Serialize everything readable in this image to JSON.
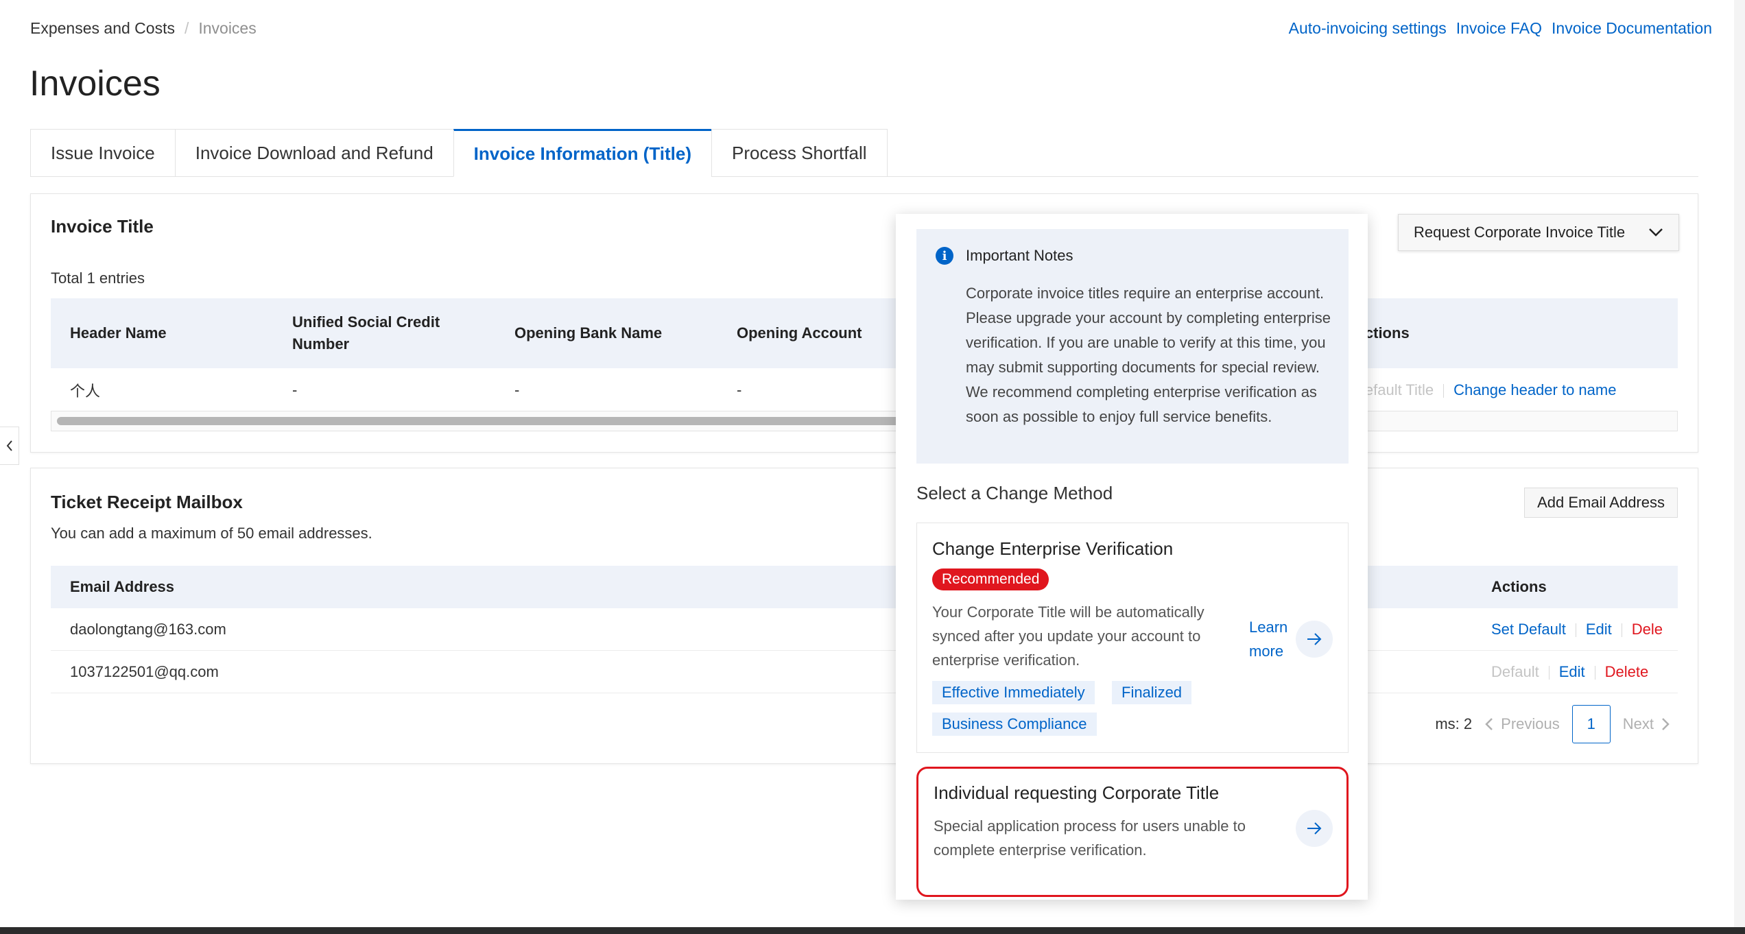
{
  "breadcrumb": {
    "parent": "Expenses and Costs",
    "separator": "/",
    "current": "Invoices"
  },
  "top_links": {
    "auto_invoicing": "Auto-invoicing settings",
    "faq": "Invoice FAQ",
    "docs": "Invoice Documentation"
  },
  "page": {
    "title": "Invoices"
  },
  "tabs": [
    {
      "label": "Issue Invoice"
    },
    {
      "label": "Invoice Download and Refund"
    },
    {
      "label": "Invoice Information (Title)"
    },
    {
      "label": "Process Shortfall"
    }
  ],
  "invoice_title_card": {
    "title": "Invoice Title",
    "total": "Total 1 entries",
    "request_button": "Request Corporate Invoice Title",
    "columns": [
      "Header Name",
      "Unified Social Credit Number",
      "Opening Bank Name",
      "Opening Account",
      "Actions"
    ],
    "row": {
      "header_name": "个人",
      "credit_number": "-",
      "bank_name": "-",
      "account": "-"
    },
    "actions": {
      "default_title": "Default Title",
      "change_header": "Change header to name"
    }
  },
  "mailbox_card": {
    "title": "Ticket Receipt Mailbox",
    "subtitle": "You can add a maximum of 50 email addresses.",
    "add_button": "Add Email Address",
    "columns": {
      "email": "Email Address",
      "actions": "Actions"
    },
    "rows": [
      {
        "email": "daolongtang@163.com",
        "default": "Set Default",
        "edit": "Edit",
        "delete": "Dele"
      },
      {
        "email": "1037122501@qq.com",
        "default": "Default",
        "edit": "Edit",
        "delete": "Delete"
      }
    ],
    "pagination": {
      "items_label": "ms: 2",
      "previous": "Previous",
      "page": "1",
      "next": "Next"
    }
  },
  "dropdown": {
    "notice_title": "Important Notes",
    "notice_body": "Corporate invoice titles require an enterprise account. Please upgrade your account by completing enterprise verification. If you are unable to verify at this time, you may submit supporting documents for special review. We recommend completing enterprise verification as soon as possible to enjoy full service benefits.",
    "method_heading": "Select a Change Method",
    "option_1": {
      "title": "Change Enterprise Verification",
      "badge": "Recommended",
      "description": "Your Corporate Title will be automatically synced after you update your account to enterprise verification.",
      "learn_more": "Learn more",
      "tags": [
        "Effective Immediately",
        "Finalized",
        "Business Compliance"
      ]
    },
    "option_2": {
      "title": "Individual requesting Corporate Title",
      "description": "Special application process for users unable to complete enterprise verification."
    }
  },
  "colors": {
    "accent": "#0064c8",
    "danger": "#e0161e",
    "table_header": "#eef2f9"
  },
  "icons": [
    "info-icon",
    "chevron-down-icon",
    "arrow-right-icon",
    "chevron-left-icon",
    "chevron-right-icon"
  ]
}
